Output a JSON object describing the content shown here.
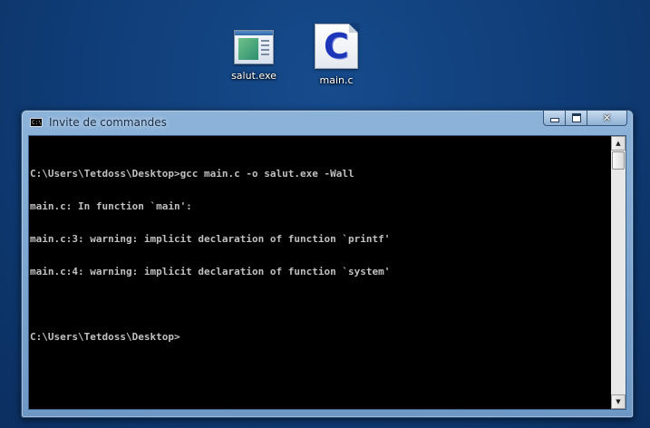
{
  "desktop": {
    "icons": [
      {
        "label": "salut.exe",
        "icon": "exe-window-icon"
      },
      {
        "label": "main.c",
        "icon": "c-source-file-icon",
        "glyph": "C"
      }
    ]
  },
  "window": {
    "title": "Invite de commandes",
    "icon_text": "C:\\",
    "min_label": "",
    "close_label": "✕",
    "lines": [
      "C:\\Users\\Tetdoss\\Desktop>gcc main.c -o salut.exe -Wall",
      "main.c: In function `main':",
      "main.c:3: warning: implicit declaration of function `printf'",
      "main.c:4: warning: implicit declaration of function `system'",
      "",
      "C:\\Users\\Tetdoss\\Desktop>"
    ],
    "scroll_up": "▲",
    "scroll_down": "▼"
  },
  "colors": {
    "desktop_bg": "#0f3c76",
    "console_bg": "#000000",
    "console_text": "#c0c0c0",
    "window_frame": "#7fa7d0"
  }
}
